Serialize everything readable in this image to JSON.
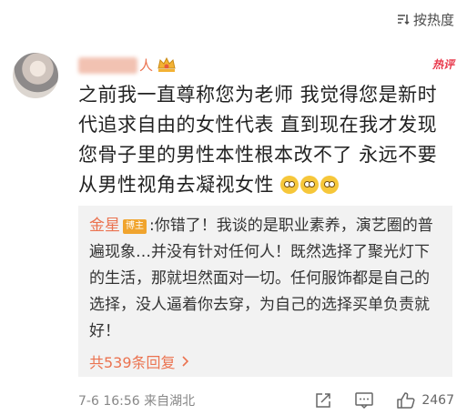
{
  "sort": {
    "label": "按热度"
  },
  "comment": {
    "username_visible": "人",
    "hot_label": "热评",
    "text": "之前我一直尊称您为老师 我觉得您是新时代追求自由的女性代表 直到现在我才发现您骨子里的男性本性根本改不了 永远不要从男性视角去凝视女性"
  },
  "reply": {
    "author": "金星",
    "badge": "博主",
    "text": ":你错了！我谈的是职业素养，演艺圈的普遍现象…并没有针对任何人！既然选择了聚光灯下的生活，那就坦然面对一切。任何服饰都是自己的选择，没人逼着你去穿，为自己的选择买单负责就好！",
    "count_label": "共539条回复"
  },
  "footer": {
    "meta": "7-6 16:56 来自湖北",
    "like_count": "2467"
  },
  "colors": {
    "accent": "#eb7350",
    "hot": "#e8374a",
    "reply_bg": "#f2f2f2"
  },
  "icons": [
    "sort-icon",
    "avatar",
    "crown-icon",
    "emoji",
    "chevron-right-icon",
    "share-icon",
    "comment-icon",
    "like-icon"
  ]
}
